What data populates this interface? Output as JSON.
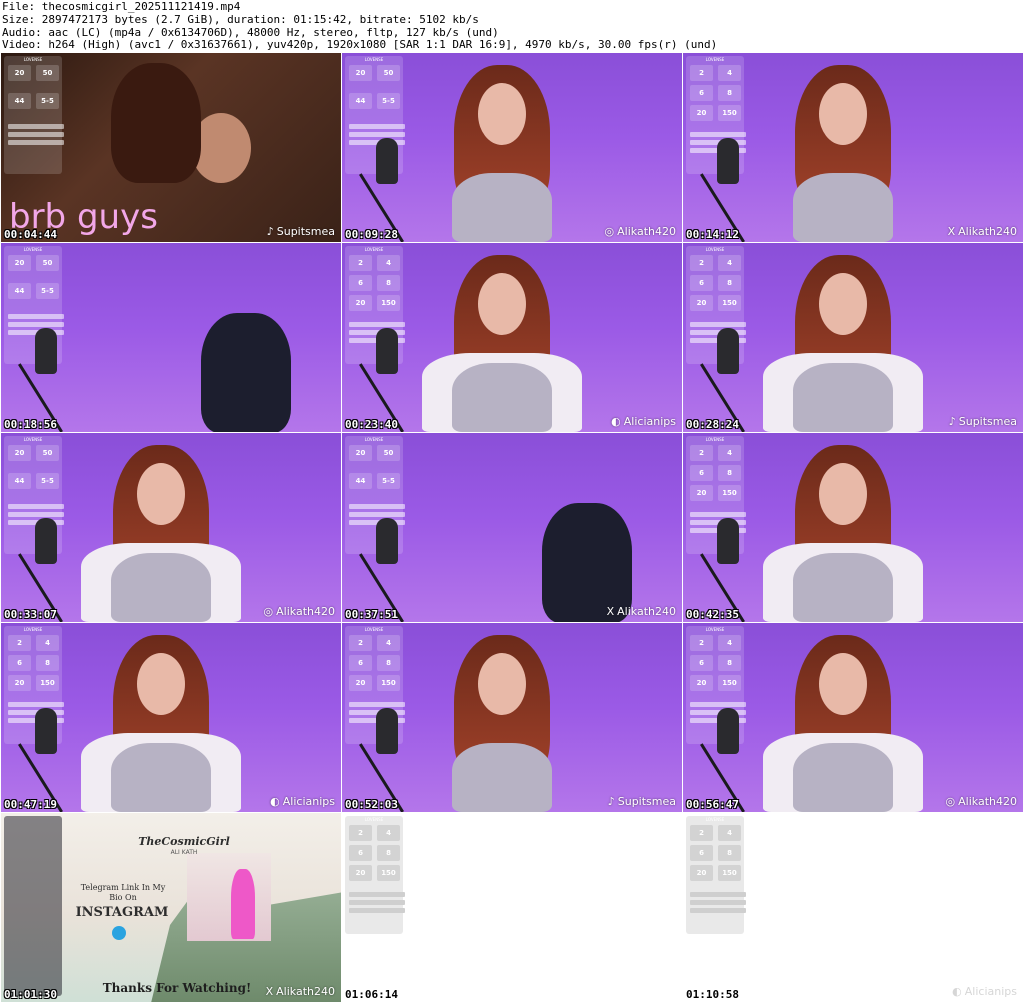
{
  "header": {
    "file": "File: thecosmicgirl_202511121419.mp4",
    "size": "Size: 2897472173 bytes (2.7 GiB), duration: 01:15:42, bitrate: 5102 kb/s",
    "audio": "Audio: aac (LC) (mp4a / 0x6134706D), 48000 Hz, stereo, fltp, 127 kb/s (und)",
    "video": "Video: h264 (High) (avc1 / 0x31637661), yuv420p, 1920x1080 [SAR 1:1 DAR 16:9], 4970 kb/s, 30.00 fps(r) (und)"
  },
  "panel": {
    "brand": "LOVENSE",
    "cells": [
      "20",
      "50",
      "44",
      "5-5"
    ],
    "cells_alt": [
      "2",
      "4",
      "6",
      "8",
      "20",
      "150"
    ]
  },
  "brb_text": "brb guys",
  "promo": {
    "title": "TheCosmicGirl",
    "subtitle": "ALI KATH",
    "telegram": "Telegram Link In My Bio On",
    "instagram": "INSTAGRAM",
    "thanks": "Thanks For Watching!"
  },
  "thumbs": [
    {
      "time": "00:04:44",
      "watermark": "Supitsmea",
      "wm_icon": "tiktok-icon",
      "wm_glyph": "♪"
    },
    {
      "time": "00:09:28",
      "watermark": "Alikath420",
      "wm_icon": "instagram-icon",
      "wm_glyph": "◎"
    },
    {
      "time": "00:14:12",
      "watermark": "Alikath240",
      "wm_icon": "x-icon",
      "wm_glyph": "X"
    },
    {
      "time": "00:18:56",
      "watermark": "",
      "wm_icon": "",
      "wm_glyph": ""
    },
    {
      "time": "00:23:40",
      "watermark": "Alicianips",
      "wm_icon": "onlyfans-icon",
      "wm_glyph": "◐"
    },
    {
      "time": "00:28:24",
      "watermark": "Supitsmea",
      "wm_icon": "tiktok-icon",
      "wm_glyph": "♪"
    },
    {
      "time": "00:33:07",
      "watermark": "Alikath420",
      "wm_icon": "instagram-icon",
      "wm_glyph": "◎"
    },
    {
      "time": "00:37:51",
      "watermark": "Alikath240",
      "wm_icon": "x-icon",
      "wm_glyph": "X"
    },
    {
      "time": "00:42:35",
      "watermark": "",
      "wm_icon": "",
      "wm_glyph": ""
    },
    {
      "time": "00:47:19",
      "watermark": "Alicianips",
      "wm_icon": "onlyfans-icon",
      "wm_glyph": "◐"
    },
    {
      "time": "00:52:03",
      "watermark": "Supitsmea",
      "wm_icon": "tiktok-icon",
      "wm_glyph": "♪"
    },
    {
      "time": "00:56:47",
      "watermark": "Alikath420",
      "wm_icon": "instagram-icon",
      "wm_glyph": "◎"
    },
    {
      "time": "01:01:30",
      "watermark": "Alikath240",
      "wm_icon": "x-icon",
      "wm_glyph": "X"
    },
    {
      "time": "01:06:14",
      "watermark": "",
      "wm_icon": "",
      "wm_glyph": ""
    },
    {
      "time": "01:10:58",
      "watermark": "Alicianips",
      "wm_icon": "onlyfans-icon",
      "wm_glyph": "◐"
    }
  ],
  "colors": {
    "background": "#ffffff",
    "room_purple": "#9b5ae6",
    "brb_pink": "#f2a7e8",
    "timestamp": "#ffffff"
  }
}
